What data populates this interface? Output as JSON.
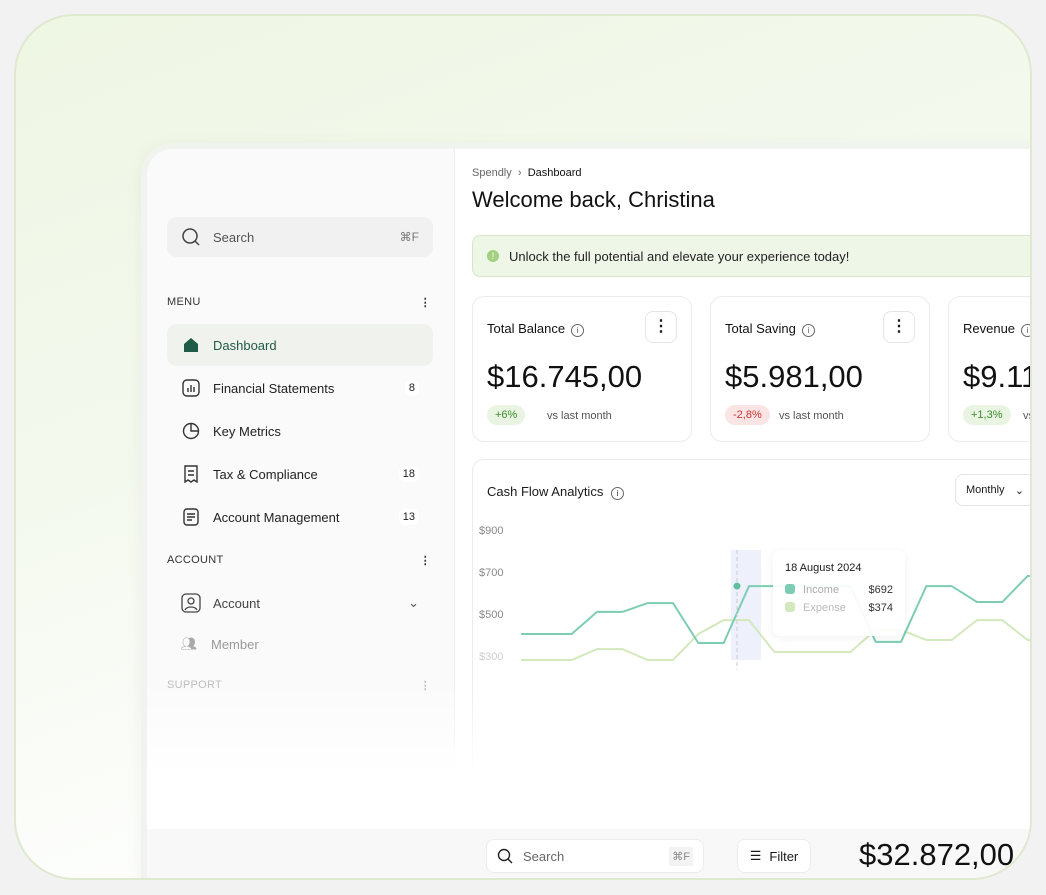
{
  "sidebar": {
    "search": {
      "placeholder": "Search",
      "shortcut": "⌘F"
    },
    "menu_label": "MENU",
    "items": [
      {
        "label": "Dashboard",
        "icon": "home-icon",
        "active": true
      },
      {
        "label": "Financial Statements",
        "icon": "bar-chart-icon",
        "badge": "8"
      },
      {
        "label": "Key Metrics",
        "icon": "pie-chart-icon"
      },
      {
        "label": "Tax & Compliance",
        "icon": "receipt-icon",
        "badge": "18"
      },
      {
        "label": "Account Management",
        "icon": "document-icon",
        "badge": "13"
      }
    ],
    "account_label": "ACCOUNT",
    "account_items": [
      {
        "label": "Account",
        "icon": "user-icon"
      },
      {
        "label": "Member",
        "icon": "users-icon"
      }
    ],
    "support_label": "SUPPORT"
  },
  "header": {
    "breadcrumb": [
      "Spendly",
      "Dashboard"
    ],
    "title": "Welcome back, Christina"
  },
  "banner": "Unlock the full potential and elevate your experience today!",
  "cards": [
    {
      "title": "Total Balance",
      "value": "$16.745,00",
      "change": "+6%",
      "trend": "up",
      "vs": "vs last month"
    },
    {
      "title": "Total Saving",
      "value": "$5.981,00",
      "change": "-2,8%",
      "trend": "down",
      "vs": "vs last month"
    },
    {
      "title": "Revenue",
      "value": "$9.11",
      "change": "+1,3%",
      "trend": "up",
      "vs": "vs la"
    }
  ],
  "chart_data": {
    "type": "line",
    "title": "Cash Flow Analytics",
    "period": "Monthly",
    "y_ticks": [
      "$900",
      "$700",
      "$500",
      "$300"
    ],
    "ylim": [
      100,
      900
    ],
    "grid": false,
    "series": [
      {
        "name": "Income",
        "color": "#7ccdb4",
        "values": [
          405,
          405,
          405,
          510,
          510,
          552,
          552,
          362,
          362,
          633,
          633,
          633,
          633,
          633,
          367,
          367,
          633,
          633,
          557,
          557,
          681,
          681
        ]
      },
      {
        "name": "Expense",
        "color": "#d4e8bd",
        "values": [
          281,
          281,
          281,
          333,
          333,
          281,
          281,
          405,
          471,
          471,
          319,
          319,
          319,
          319,
          424,
          424,
          376,
          376,
          471,
          471,
          376,
          376
        ]
      }
    ],
    "tooltip": {
      "date": "18 August 2024",
      "rows": [
        {
          "name": "Income",
          "value": "$692"
        },
        {
          "name": "Expense",
          "value": "$374"
        }
      ]
    }
  },
  "bottom": {
    "search": {
      "placeholder": "Search",
      "shortcut": "⌘F"
    },
    "filter": "Filter",
    "amount": "$32.872,00"
  }
}
